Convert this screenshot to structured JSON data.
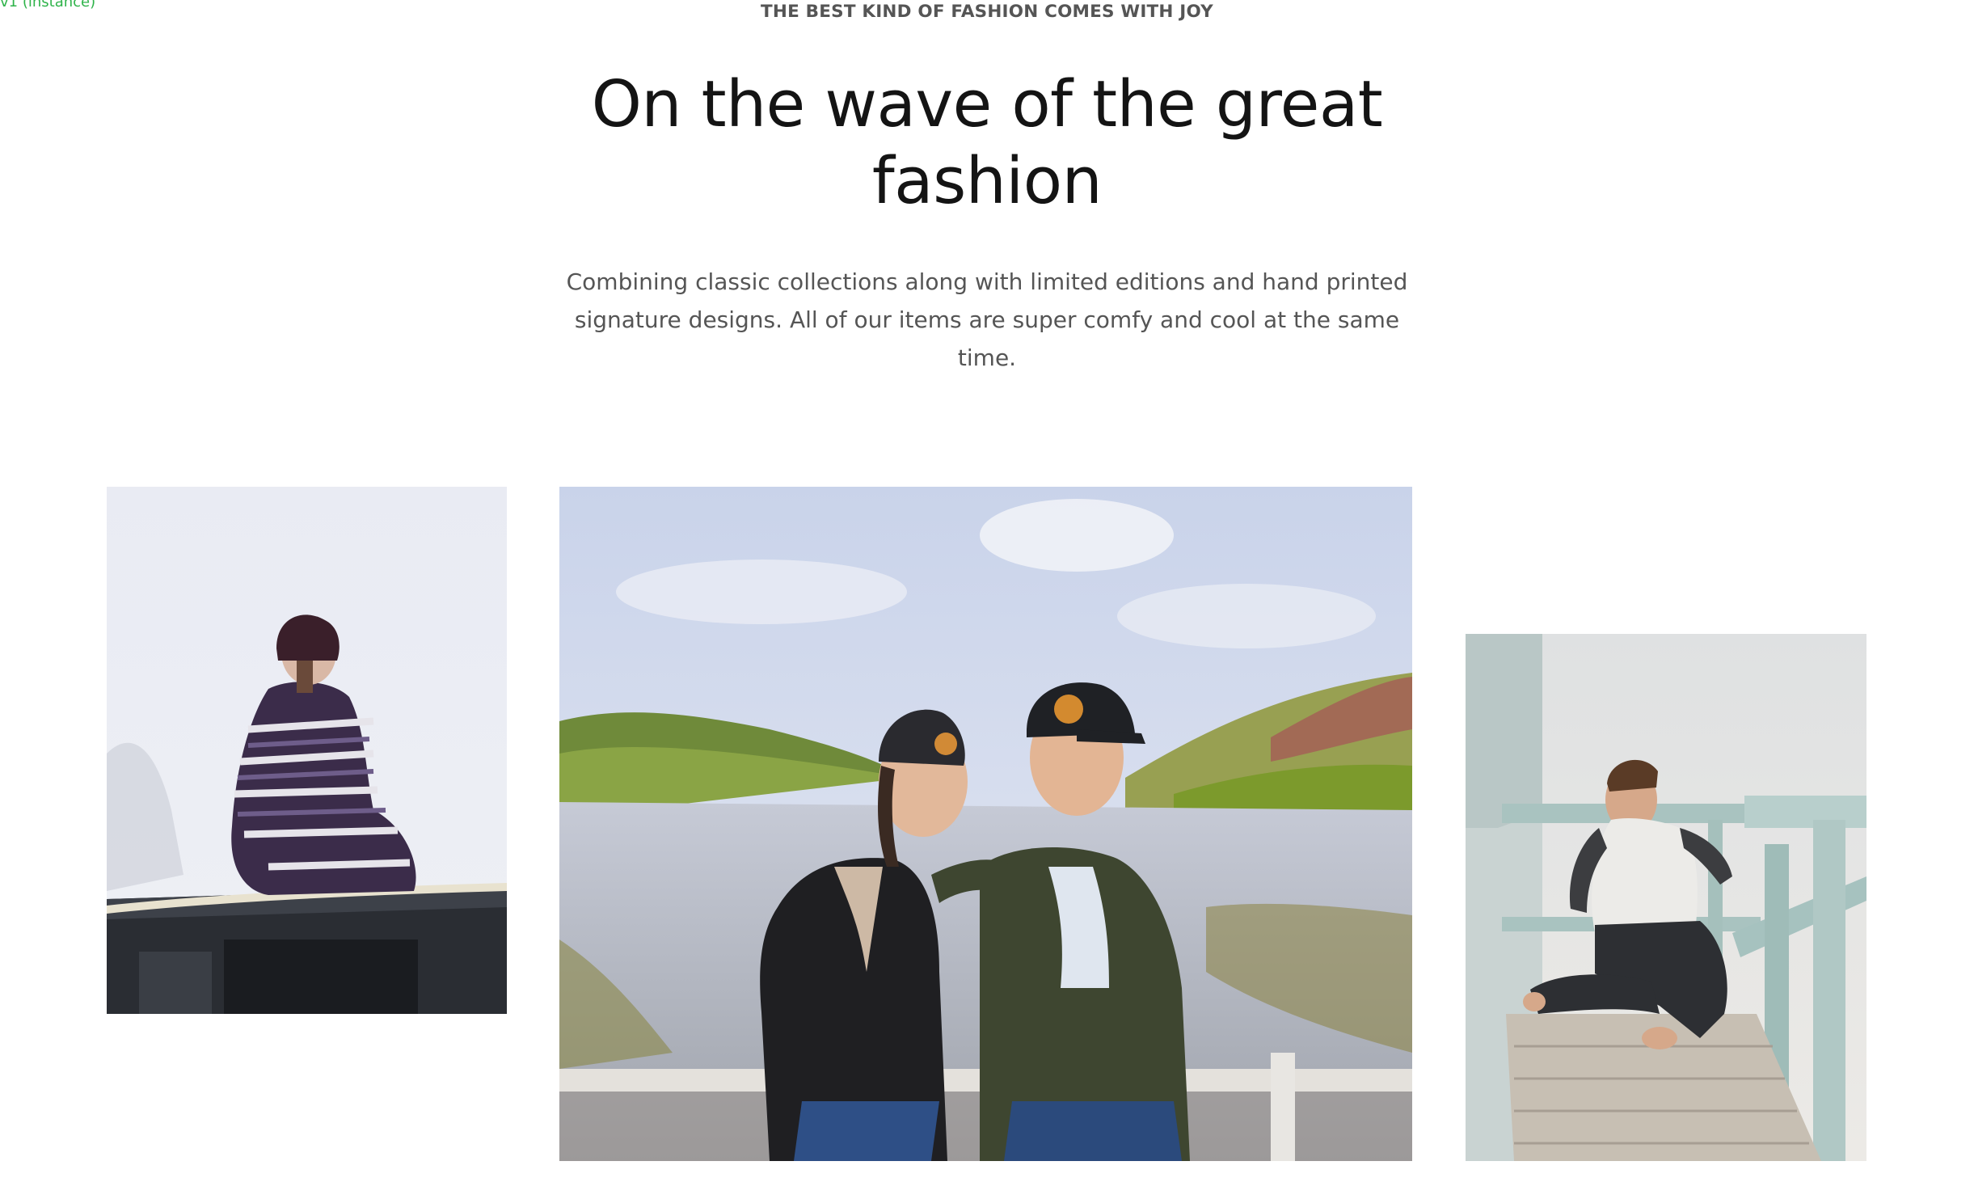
{
  "debug_label": "v1 (instance)",
  "hero": {
    "eyebrow": "THE BEST KIND OF FASHION COMES WITH JOY",
    "headline": "On the wave of the great fashion",
    "lead": "Combining classic collections along with limited editions and hand printed signature designs. All of our items are super comfy and cool at the same time."
  },
  "gallery": {
    "images": [
      {
        "id": "left",
        "subject": "woman in beanie and striped blanket sitting on a car roof in fog"
      },
      {
        "id": "main",
        "subject": "smiling couple in beanie and cap sitting on a railing by a lake and green hills"
      },
      {
        "id": "right",
        "subject": "laughing man in raglan tee sitting barefoot on a lifeguard tower deck"
      }
    ]
  },
  "colors": {
    "text_dark": "#141414",
    "text_muted": "#555555",
    "debug_green": "#2fb34a"
  }
}
